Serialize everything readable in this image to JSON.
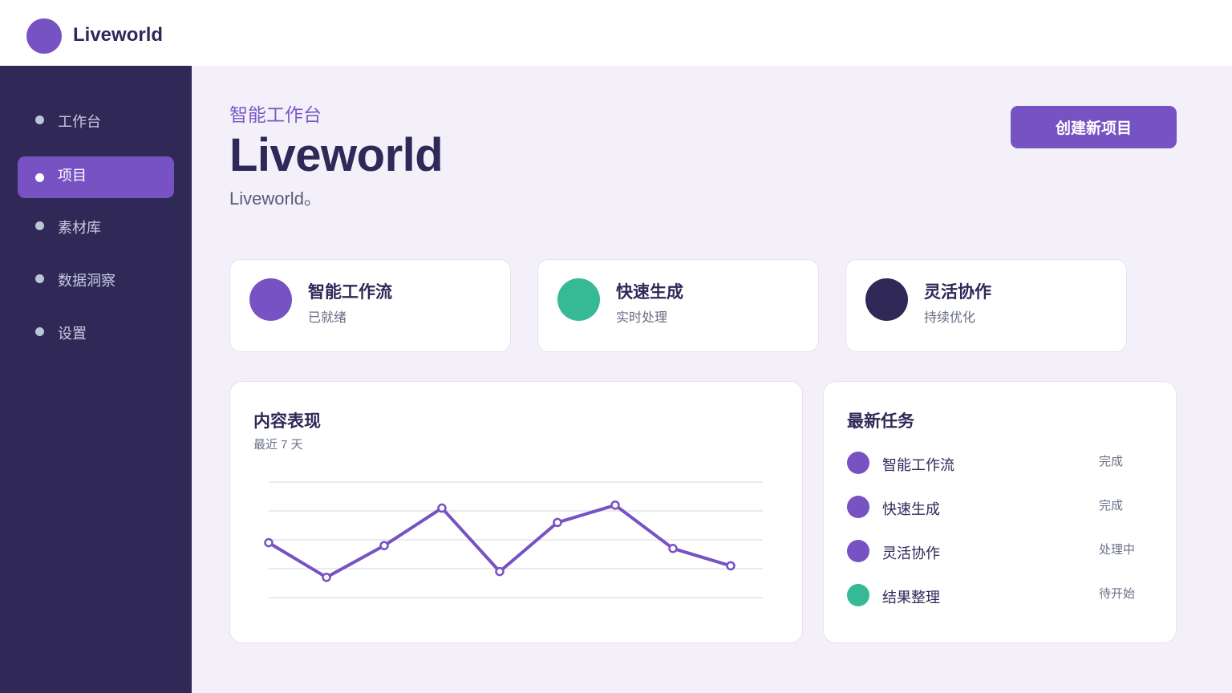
{
  "app": {
    "brand": "Liveworld"
  },
  "sidebar": {
    "items": [
      {
        "label": "工作台",
        "active": false
      },
      {
        "label": "项目",
        "active": true
      },
      {
        "label": "素材库",
        "active": false
      },
      {
        "label": "数据洞察",
        "active": false
      },
      {
        "label": "设置",
        "active": false
      }
    ]
  },
  "header": {
    "eyebrow": "智能工作台",
    "title": "Liveworld",
    "subtitle": "Liveworld。",
    "create_button": "创建新项目"
  },
  "stats": [
    {
      "title": "智能工作流",
      "sub": "已就绪",
      "color": "#7752c2"
    },
    {
      "title": "快速生成",
      "sub": "实时处理",
      "color": "#36b995"
    },
    {
      "title": "灵活协作",
      "sub": "持续优化",
      "color": "#302857"
    }
  ],
  "performance": {
    "title": "内容表现",
    "subtitle": "最近 7 天"
  },
  "tasks": {
    "title": "最新任务",
    "items": [
      {
        "name": "智能工作流",
        "status": "完成",
        "color": "#7752c2"
      },
      {
        "name": "快速生成",
        "status": "完成",
        "color": "#7752c2"
      },
      {
        "name": "灵活协作",
        "status": "处理中",
        "color": "#7752c2"
      },
      {
        "name": "结果整理",
        "status": "待开始",
        "color": "#36b995"
      }
    ]
  },
  "colors": {
    "accent": "#7752c2",
    "green": "#36b995",
    "navy": "#302857",
    "background": "#f3f0fa"
  },
  "chart_data": {
    "type": "line",
    "grid": true,
    "ylim": [
      0,
      4
    ],
    "series": [
      {
        "values": [
          1.9,
          0.7,
          1.8,
          3.1,
          0.9,
          2.6,
          3.2,
          1.7,
          1.1
        ]
      }
    ]
  }
}
